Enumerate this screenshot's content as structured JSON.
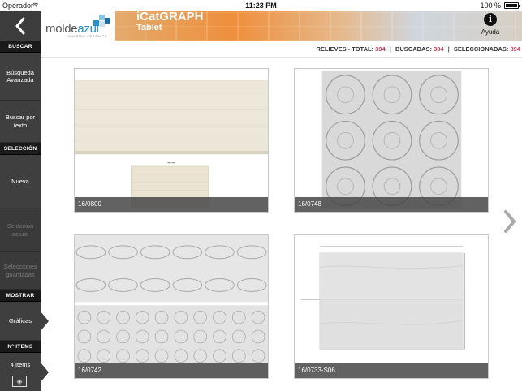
{
  "status": {
    "carrier": "Operador",
    "time": "11:23 PM",
    "battery": "100 %"
  },
  "header": {
    "logo_text_a": "molde",
    "logo_text_b": "azul",
    "logo_tagline": "SHAPING CERAMICS",
    "title": "iCatGRAPH",
    "subtitle": "Tablet",
    "help_label": "Ayuda"
  },
  "sidebar": {
    "section_search": "BUSCAR",
    "advanced_search": "Búsqueda Avanzada",
    "text_search": "Buscar por texto",
    "section_selection": "SELECCIÓN",
    "new": "Nueva",
    "current_selection": "Seleccion actual",
    "saved_selections": "Selecciones guardadas",
    "section_show": "MOSTRAR",
    "graphics": "Gráficas",
    "section_items": "Nº ITEMS",
    "items_count": "4 Items"
  },
  "counts": {
    "label_total": "RELIEVES -  TOTAL:",
    "total": "394",
    "label_found": "BUSCADAS:",
    "found": "394",
    "label_selected": "SELECCIONADAS:",
    "selected": "394"
  },
  "cards": [
    {
      "code": "16/0800"
    },
    {
      "code": "16/0748"
    },
    {
      "code": "16/0742"
    },
    {
      "code": "16/0733-S06"
    }
  ],
  "colors": {
    "accent_count": "#c43a56",
    "sidebar": "#3f3f3f",
    "sidebar_section": "#1a1a1a"
  }
}
